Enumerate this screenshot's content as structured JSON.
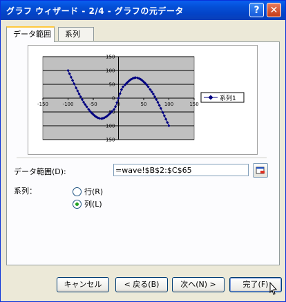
{
  "window": {
    "title": "グラフ ウィザード - 2/4 - グラフの元データ",
    "help_glyph": "?",
    "close_glyph": "✕"
  },
  "tabs": [
    {
      "label": "データ範囲",
      "active": true
    },
    {
      "label": "系列",
      "active": false
    }
  ],
  "chart_data": {
    "type": "scatter",
    "title": "",
    "xlabel": "",
    "ylabel": "",
    "xlim": [
      -150,
      150
    ],
    "ylim": [
      -150,
      150
    ],
    "xticks": [
      "-150",
      "-100",
      "-50",
      "0",
      "50",
      "100",
      "150"
    ],
    "yticks": [
      "150",
      "100",
      "50",
      "0",
      "-50",
      "-100",
      "-150"
    ],
    "grid": true,
    "plot_bg": "#C0C0C0",
    "legend_position": "right",
    "series": [
      {
        "name": "系列1",
        "color": "#000080",
        "marker": "diamond",
        "x": [
          -100,
          -97,
          -94,
          -91,
          -88,
          -84,
          -81,
          -78,
          -75,
          -72,
          -69,
          -66,
          -63,
          -59,
          -56,
          -53,
          -50,
          -47,
          -44,
          -41,
          -38,
          -34,
          -31,
          -28,
          -25,
          -22,
          -19,
          -16,
          -13,
          -9,
          -6,
          -3,
          0,
          3,
          6,
          9,
          13,
          16,
          19,
          22,
          25,
          28,
          31,
          34,
          38,
          41,
          44,
          47,
          50,
          53,
          56,
          59,
          63,
          66,
          69,
          72,
          75,
          78,
          81,
          84,
          88,
          91,
          94,
          97,
          100
        ],
        "y": [
          100,
          88,
          76,
          64,
          52,
          37,
          26,
          15,
          5,
          -5,
          -15,
          -23,
          -31,
          -41,
          -48,
          -54,
          -59,
          -64,
          -68,
          -71,
          -73,
          -74,
          -73,
          -71,
          -68,
          -64,
          -59,
          -54,
          -48,
          -41,
          -31,
          -16,
          0,
          16,
          31,
          41,
          48,
          54,
          59,
          64,
          68,
          71,
          73,
          74,
          73,
          71,
          68,
          64,
          59,
          54,
          48,
          41,
          31,
          23,
          15,
          5,
          -5,
          -15,
          -26,
          -37,
          -52,
          -64,
          -76,
          -88,
          -100
        ]
      }
    ]
  },
  "source": {
    "range_label": "データ範囲(D):",
    "range_value": "=wave!$B$2:$C$65",
    "series_label": "系列：",
    "options": [
      {
        "label": "行(R)",
        "checked": false
      },
      {
        "label": "列(L)",
        "checked": true
      }
    ]
  },
  "buttons": {
    "cancel": "キャンセル",
    "back": "< 戻る(B)",
    "next": "次へ(N) >",
    "finish": "完了(F)"
  },
  "colors": {
    "titlebar": "#0450D8",
    "series": "#000080",
    "selected_radio": "#21A121"
  }
}
